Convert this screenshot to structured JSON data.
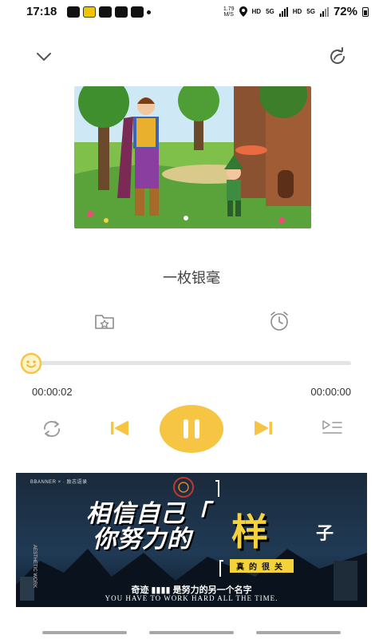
{
  "status_bar": {
    "time": "17:18",
    "net_speed_value": "1.79",
    "net_speed_unit": "M/S",
    "hd1": "HD",
    "net1": "5G",
    "hd2": "HD",
    "net2": "5G",
    "battery": "72%"
  },
  "player": {
    "title": "一枚银毫",
    "elapsed": "00:00:02",
    "total": "00:00:00",
    "progress": 0.0
  },
  "banner": {
    "tag": "BBANNER × · 励志语录",
    "line1": "相信自己「",
    "line2": "你努力的",
    "big_char": "样",
    "suffix": "子",
    "pill": "真的很关",
    "subtitle": "奇迹 ▮▮▮▮ 是努力的另一个名字",
    "english": "YOU HAVE TO WORK HARD ALL THE TIME.",
    "side_text": "AESTHETIC WORK"
  },
  "colors": {
    "accent": "#f5c543",
    "track": "#e4e4e4",
    "icon_gray": "#8a8a8a"
  },
  "icons": {
    "collapse": "chevron-down-icon",
    "share": "share-icon",
    "favorite": "favorite-folder-icon",
    "alarm": "alarm-clock-icon",
    "loop": "repeat-icon",
    "prev": "skip-previous-icon",
    "pause": "pause-icon",
    "next": "skip-next-icon",
    "playlist": "playlist-icon"
  }
}
